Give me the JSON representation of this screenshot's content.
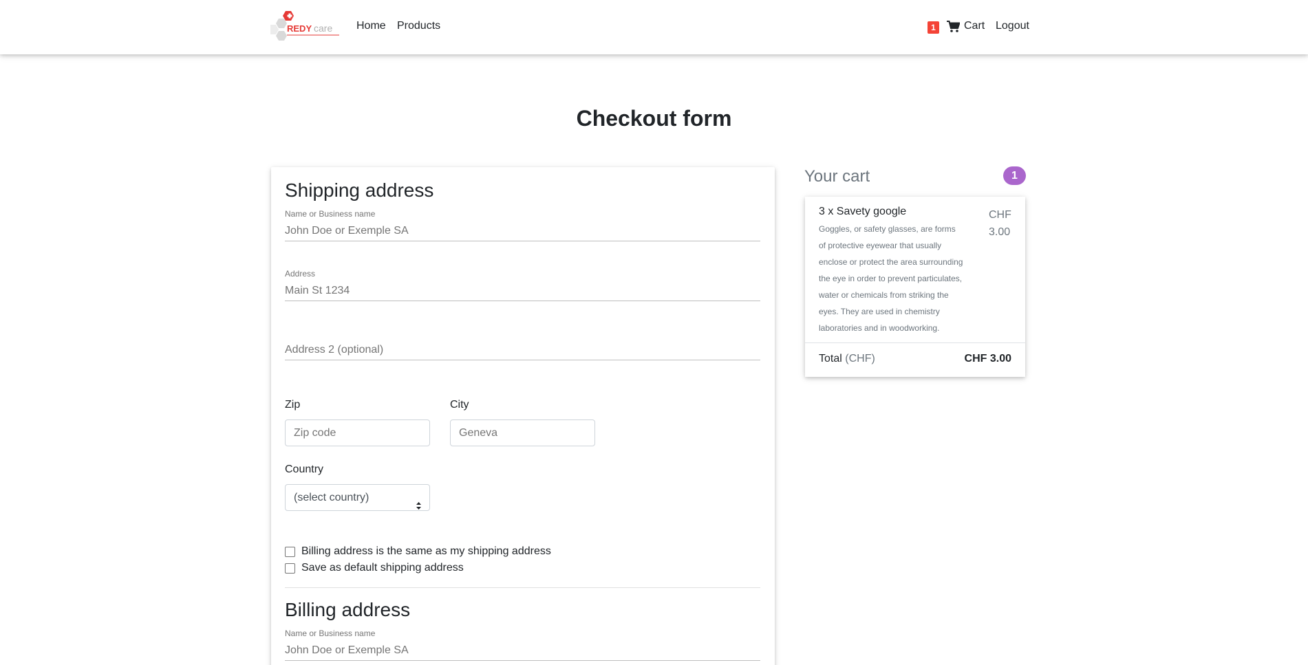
{
  "navbar": {
    "logo_text_main": "REDY",
    "logo_text_sub": "care",
    "home_label": "Home",
    "products_label": "Products",
    "cart_badge": "1",
    "cart_label": "Cart",
    "logout_label": "Logout"
  },
  "page": {
    "title": "Checkout form"
  },
  "shipping": {
    "title": "Shipping address",
    "name_label": "Name or Business name",
    "name_placeholder": "John Doe or Exemple SA",
    "address_label": "Address",
    "address_placeholder": "Main St 1234",
    "address2_placeholder": "Address 2 (optional)",
    "zip_label": "Zip",
    "zip_placeholder": "Zip code",
    "city_label": "City",
    "city_placeholder": "Geneva",
    "country_label": "Country",
    "country_selected": "(select country)",
    "billing_same_label": "Billing address is the same as my shipping address",
    "billing_same_checked": false,
    "save_default_label": "Save as default shipping address",
    "save_default_checked": false
  },
  "billing": {
    "title": "Billing address",
    "name_label": "Name or Business name",
    "name_placeholder": "John Doe or Exemple SA"
  },
  "cart": {
    "title": "Your cart",
    "count": "1",
    "items": [
      {
        "name": "3 x Savety google",
        "description": "Goggles, or safety glasses, are forms of protective eyewear that usually enclose or protect the area surrounding the eye in order to prevent particulates, water or chemicals from striking the eyes. They are used in chemistry laboratories and in woodworking.",
        "price_currency": "CHF",
        "price_amount": "3.00"
      }
    ],
    "total_label": "Total",
    "total_currency": "(CHF)",
    "total_value": "CHF 3.00"
  },
  "colors": {
    "accent_badge": "#aa66cc",
    "cart_badge": "#f44336",
    "logo_red": "#e53935"
  }
}
